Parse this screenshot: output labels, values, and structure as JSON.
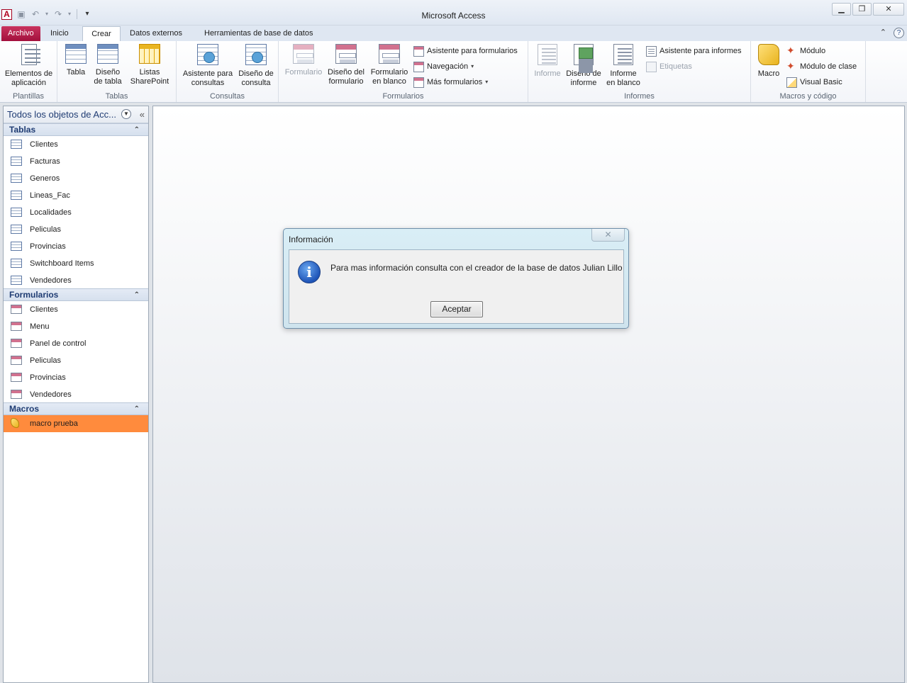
{
  "window": {
    "title": "Microsoft Access",
    "app_icon": "A"
  },
  "tabs": [
    {
      "label": "Archivo"
    },
    {
      "label": "Inicio"
    },
    {
      "label": "Crear"
    },
    {
      "label": "Datos externos"
    },
    {
      "label": "Herramientas de base de datos"
    }
  ],
  "ribbon": {
    "plantillas": {
      "label": "Plantillas",
      "elementos": "Elementos de\naplicación"
    },
    "tablas": {
      "label": "Tablas",
      "tabla": "Tabla",
      "diseno": "Diseño\nde tabla",
      "listas": "Listas\nSharePoint"
    },
    "consultas": {
      "label": "Consultas",
      "asistente": "Asistente para\nconsultas",
      "diseno": "Diseño de\nconsulta"
    },
    "formularios": {
      "label": "Formularios",
      "formulario": "Formulario",
      "diseno": "Diseño del\nformulario",
      "blanco": "Formulario\nen blanco",
      "asistente": "Asistente para formularios",
      "navegacion": "Navegación",
      "mas": "Más formularios"
    },
    "informes": {
      "label": "Informes",
      "informe": "Informe",
      "diseno": "Diseño de\ninforme",
      "blanco": "Informe\nen blanco",
      "asistente": "Asistente para informes",
      "etiquetas": "Etiquetas"
    },
    "macros": {
      "label": "Macros y código",
      "macro": "Macro",
      "modulo": "Módulo",
      "clase": "Módulo de clase",
      "vb": "Visual Basic"
    }
  },
  "nav": {
    "header": "Todos los objetos de Acc...",
    "groups": [
      {
        "title": "Tablas",
        "items": [
          "Clientes",
          "Facturas",
          "Generos",
          "Lineas_Fac",
          "Localidades",
          "Peliculas",
          "Provincias",
          "Switchboard Items",
          "Vendedores"
        ]
      },
      {
        "title": "Formularios",
        "items": [
          "Clientes",
          "Menu",
          "Panel de control",
          "Peliculas",
          "Provincias",
          "Vendedores"
        ]
      },
      {
        "title": "Macros",
        "items": [
          "macro prueba"
        ]
      }
    ]
  },
  "dialog": {
    "title": "Información",
    "message": "Para mas información consulta con el creador de la base de datos Julian Lillo",
    "ok_label": "Aceptar"
  },
  "colors": {
    "file_tab": "#a3103d",
    "selected_item": "#ff8b3d",
    "nav_header": "#1f3c73"
  }
}
